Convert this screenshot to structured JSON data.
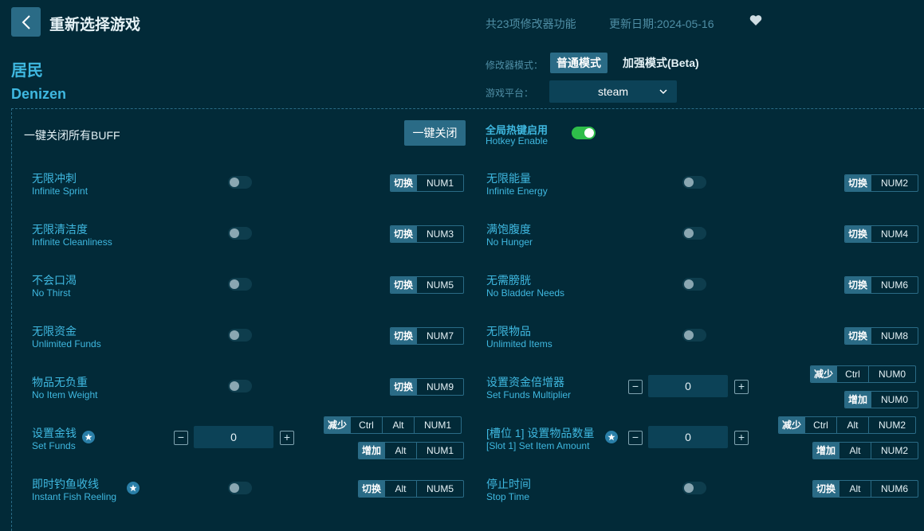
{
  "header": {
    "back_label": "<",
    "title": "重新选择游戏",
    "feature_count": "共23项修改器功能",
    "update_date": "更新日期:2024-05-16"
  },
  "game": {
    "name_cn": "居民",
    "name_en": "Denizen"
  },
  "mode": {
    "label": "修改器模式：",
    "normal": "普通模式",
    "enhanced": "加强模式(Beta)"
  },
  "platform": {
    "label": "游戏平台：",
    "selected": "steam"
  },
  "buff": {
    "label": "一键关闭所有BUFF",
    "button": "一键关闭"
  },
  "hotkey": {
    "label_cn": "全局热键启用",
    "label_en": "Hotkey Enable",
    "enabled": true
  },
  "features": [
    {
      "cn": "无限冲刺",
      "en": "Infinite Sprint",
      "action": "切换",
      "key": "NUM1"
    },
    {
      "cn": "无限能量",
      "en": "Infinite Energy",
      "action": "切换",
      "key": "NUM2"
    },
    {
      "cn": "无限清洁度",
      "en": "Infinite Cleanliness",
      "action": "切换",
      "key": "NUM3"
    },
    {
      "cn": "满饱腹度",
      "en": "No Hunger",
      "action": "切换",
      "key": "NUM4"
    },
    {
      "cn": "不会口渴",
      "en": "No Thirst",
      "action": "切换",
      "key": "NUM5"
    },
    {
      "cn": "无需膀胱",
      "en": "No Bladder Needs",
      "action": "切换",
      "key": "NUM6"
    },
    {
      "cn": "无限资金",
      "en": "Unlimited Funds",
      "action": "切换",
      "key": "NUM7"
    },
    {
      "cn": "无限物品",
      "en": "Unlimited Items",
      "action": "切换",
      "key": "NUM8"
    },
    {
      "cn": "物品无负重",
      "en": "No Item Weight",
      "action": "切换",
      "key": "NUM9"
    },
    {
      "cn": "设置资金倍增器",
      "en": "Set Funds Multiplier",
      "value": "0",
      "dec": {
        "action": "减少",
        "mod": "Ctrl",
        "key": "NUM0"
      },
      "inc": {
        "action": "增加",
        "key": "NUM0"
      }
    },
    {
      "cn": "设置金钱",
      "en": "Set Funds",
      "value": "0",
      "dec": {
        "action": "减少",
        "mod1": "Ctrl",
        "mod2": "Alt",
        "key": "NUM1"
      },
      "inc": {
        "action": "增加",
        "mod": "Alt",
        "key": "NUM1"
      }
    },
    {
      "cn": "[槽位 1] 设置物品数量",
      "en": "[Slot 1] Set Item Amount",
      "value": "0",
      "dec": {
        "action": "减少",
        "mod1": "Ctrl",
        "mod2": "Alt",
        "key": "NUM2"
      },
      "inc": {
        "action": "增加",
        "mod": "Alt",
        "key": "NUM2"
      }
    },
    {
      "cn": "即时钓鱼收线",
      "en": "Instant Fish Reeling",
      "action": "切换",
      "mod": "Alt",
      "key": "NUM5"
    },
    {
      "cn": "停止时间",
      "en": "Stop Time",
      "action": "切换",
      "mod": "Alt",
      "key": "NUM6"
    }
  ],
  "colors": {
    "background": "#022a38",
    "accent": "#3fb8e0",
    "button": "#2a6b86",
    "toggle_on": "#2ebd4a"
  }
}
